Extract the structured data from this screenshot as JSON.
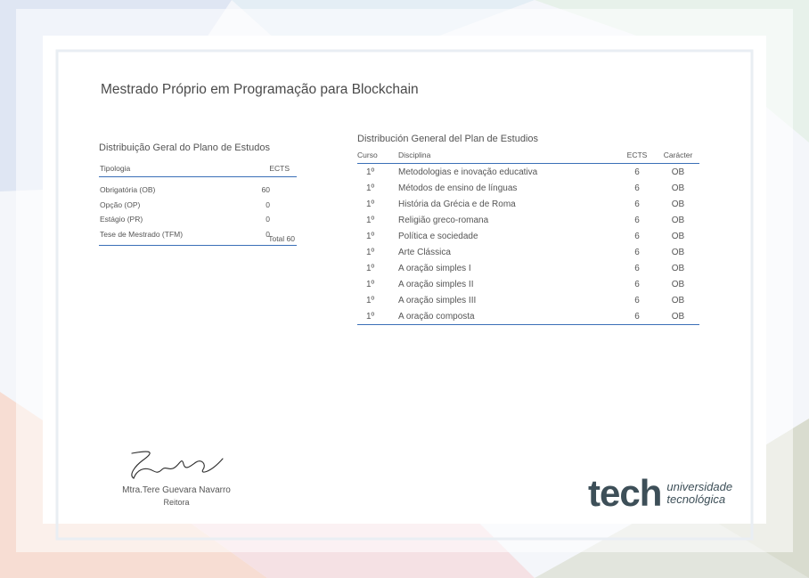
{
  "title": "Mestrado Próprio em Programação para Blockchain",
  "general_distribution": {
    "title": "Distribuição Geral do Plano de Estudos",
    "col_type": "Tipologia",
    "col_ects": "ECTS",
    "rows": [
      {
        "type": "Obrigatória (OB)",
        "ects": "60"
      },
      {
        "type": "Opção (OP)",
        "ects": "0"
      },
      {
        "type": "Estágio (PR)",
        "ects": "0"
      },
      {
        "type": "Tese de Mestrado (TFM)",
        "ects": "0"
      }
    ],
    "total": "Total 60"
  },
  "study_plan": {
    "title": "Distribución General del Plan de Estudios",
    "headers": {
      "course": "Curso",
      "subject": "Disciplina",
      "ects": "ECTS",
      "character": "Carácter"
    },
    "rows": [
      {
        "course": "1º",
        "subject": "Metodologias e inovação educativa",
        "ects": "6",
        "character": "OB"
      },
      {
        "course": "1º",
        "subject": "Métodos de ensino de línguas",
        "ects": "6",
        "character": "OB"
      },
      {
        "course": "1º",
        "subject": "História da Grécia e de Roma",
        "ects": "6",
        "character": "OB"
      },
      {
        "course": "1º",
        "subject": "Religião greco-romana",
        "ects": "6",
        "character": "OB"
      },
      {
        "course": "1º",
        "subject": "Política e sociedade",
        "ects": "6",
        "character": "OB"
      },
      {
        "course": "1º",
        "subject": "Arte Clássica",
        "ects": "6",
        "character": "OB"
      },
      {
        "course": "1º",
        "subject": "A oração simples I",
        "ects": "6",
        "character": "OB"
      },
      {
        "course": "1º",
        "subject": "A oração simples II",
        "ects": "6",
        "character": "OB"
      },
      {
        "course": "1º",
        "subject": "A oração simples III",
        "ects": "6",
        "character": "OB"
      },
      {
        "course": "1º",
        "subject": "A oração composta",
        "ects": "6",
        "character": "OB"
      }
    ]
  },
  "signature": {
    "name": "Mtra.Tere Guevara Navarro",
    "role": "Reitora"
  },
  "logo": {
    "word": "tech",
    "line1": "universidade",
    "line2": "tecnológica"
  },
  "colors": {
    "accent_line": "#3a6fb7",
    "logo": "#3d4f58"
  }
}
